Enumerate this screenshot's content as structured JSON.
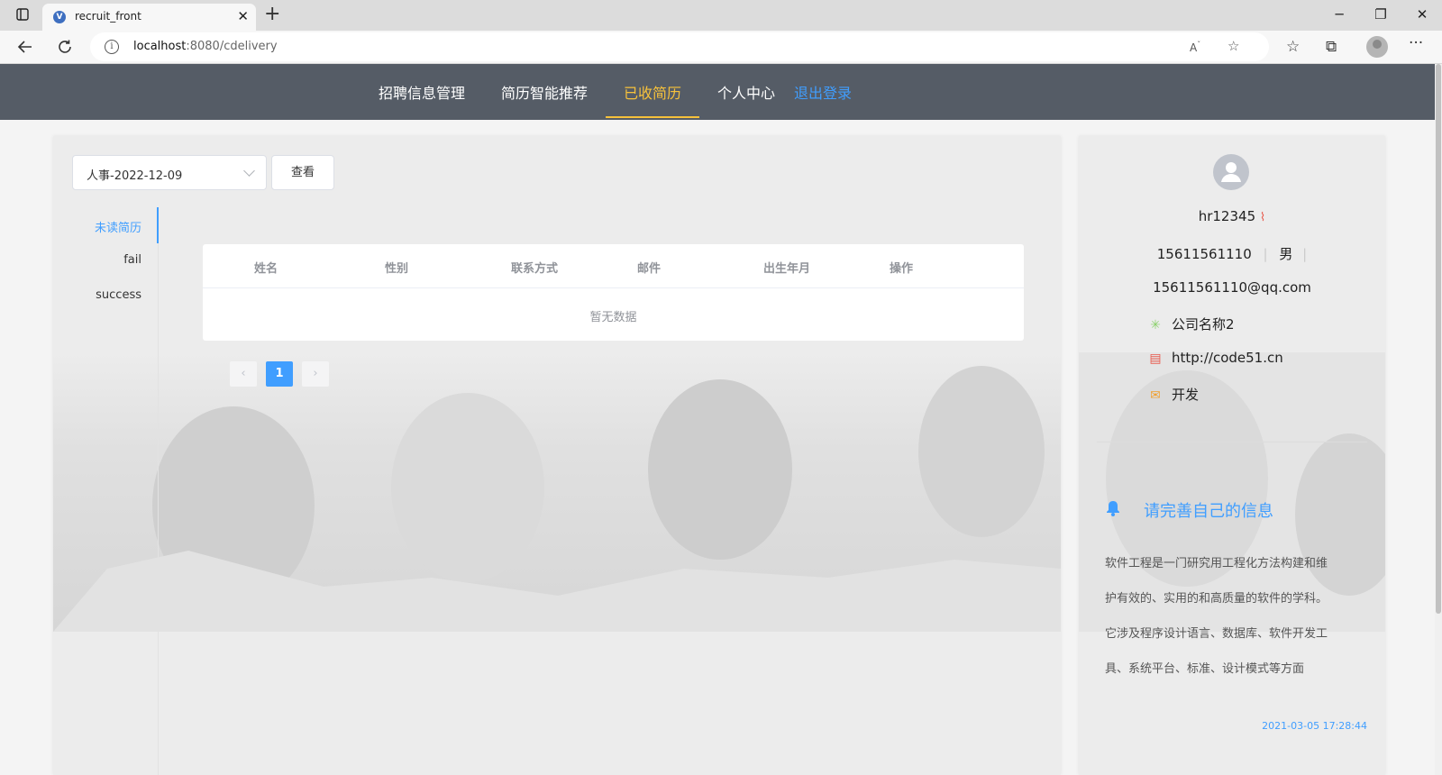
{
  "browser": {
    "tab_title": "recruit_front",
    "tab_close": "✕",
    "new_tab": "+",
    "url_host": "localhost",
    "url_path": ":8080/cdelivery",
    "window_controls": [
      "─",
      "❐",
      "✕"
    ]
  },
  "nav": {
    "items": [
      "招聘信息管理",
      "简历智能推荐",
      "已收简历",
      "个人中心"
    ],
    "active_index": 2,
    "logout": "退出登录"
  },
  "filter": {
    "select_value": "人事-2022-12-09",
    "view_button": "查看"
  },
  "tabs": [
    "未读简历",
    "fail",
    "success"
  ],
  "active_tab_index": 0,
  "table": {
    "columns": [
      "姓名",
      "性别",
      "联系方式",
      "邮件",
      "出生年月",
      "操作"
    ],
    "rows": [],
    "empty_text": "暂无数据"
  },
  "pagination": {
    "current": "1",
    "prev": "‹",
    "next": "›"
  },
  "profile": {
    "username": "hr12345",
    "phone": "15611561110",
    "gender": "男",
    "email": "15611561110@qq.com",
    "company": "公司名称2",
    "website": "http://code51.cn",
    "department": "开发"
  },
  "notice": {
    "title": "请完善自己的信息",
    "lines": [
      "软件工程是一门研究用工程化方法构建和维",
      "护有效的、实用的和高质量的软件的学科。",
      "它涉及程序设计语言、数据库、软件开发工",
      "具、系统平台、标准、设计模式等方面"
    ],
    "time": "2021-03-05 17:28:44"
  },
  "colors": {
    "header_bg": "#555c66",
    "active_nav": "#f7c23b",
    "accent": "#409eff"
  }
}
